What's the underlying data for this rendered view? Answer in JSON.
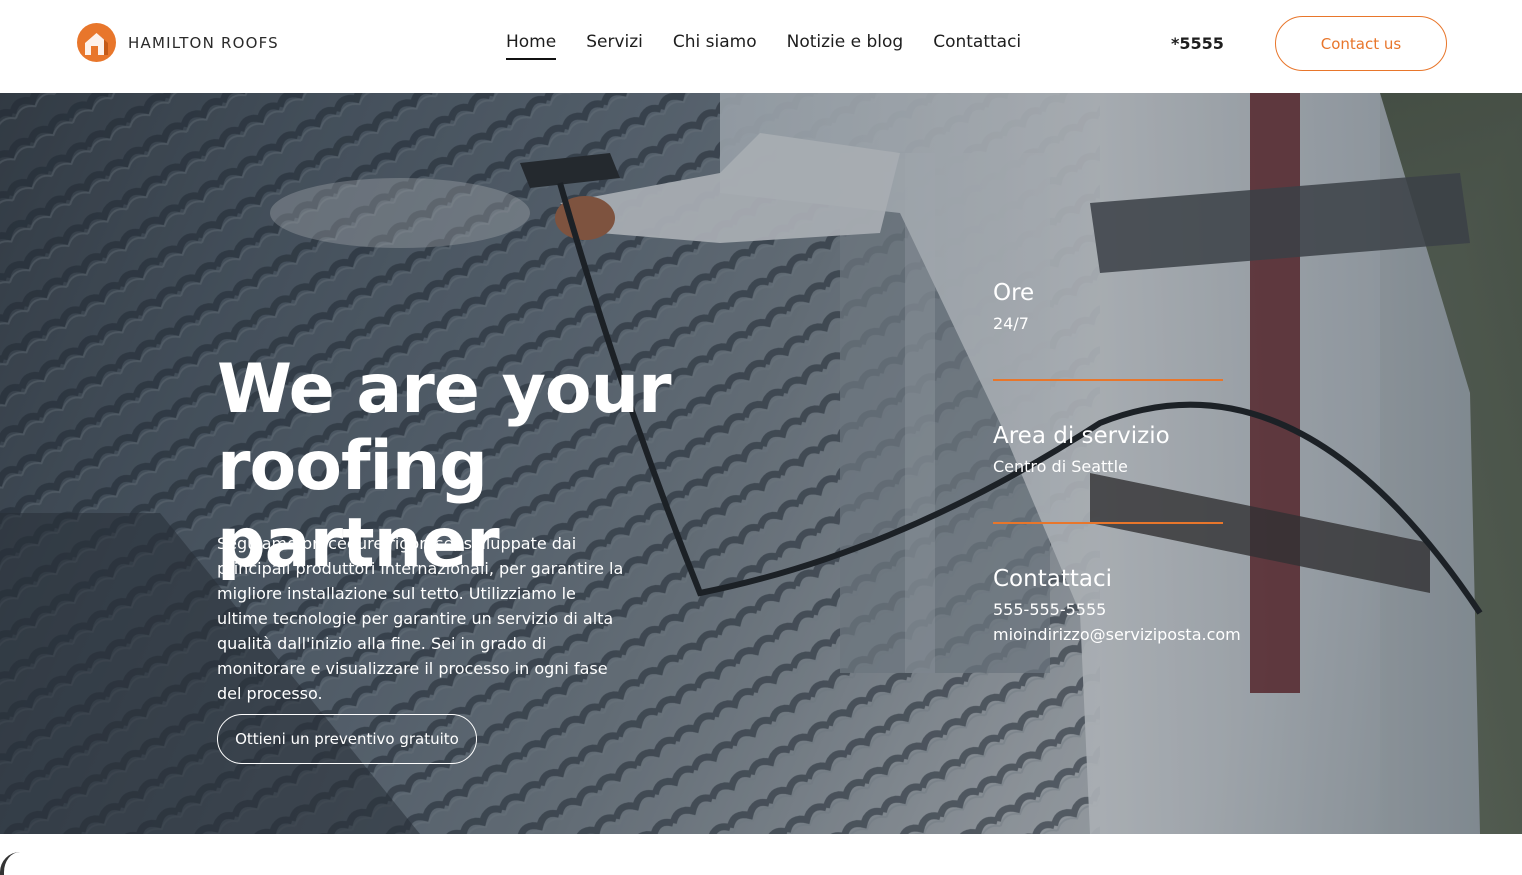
{
  "header": {
    "logo_text": "HAMILTON ROOFS",
    "nav": [
      {
        "label": "Home",
        "active": true
      },
      {
        "label": "Servizi",
        "active": false
      },
      {
        "label": "Chi siamo",
        "active": false
      },
      {
        "label": "Notizie e blog",
        "active": false
      },
      {
        "label": "Contattaci",
        "active": false
      }
    ],
    "phone_short": "*5555",
    "contact_button": "Contact us"
  },
  "hero": {
    "title_line1": "We are your",
    "title_line2": "roofing partner",
    "description": "Seguiamo procedure rigorose, sviluppate dai principali produttori internazionali, per garantire la migliore installazione sul tetto. Utilizziamo le ultime tecnologie per garantire un servizio di alta qualità dall'inizio alla fine. Sei in grado di monitorare e visualizzare il processo in ogni fase del processo.",
    "cta_button": "Ottieni un preventivo gratuito"
  },
  "info": {
    "hours_title": "Ore",
    "hours_value": "24/7",
    "area_title": "Area di servizio",
    "area_value": "Centro di Seattle",
    "contact_title": "Contattaci",
    "contact_phone": "555-555-5555",
    "contact_email": "mioindirizzo@serviziposta.com"
  },
  "colors": {
    "accent": "#e8762b",
    "text_dark": "#1e1e1e",
    "hero_text": "#ffffff"
  }
}
